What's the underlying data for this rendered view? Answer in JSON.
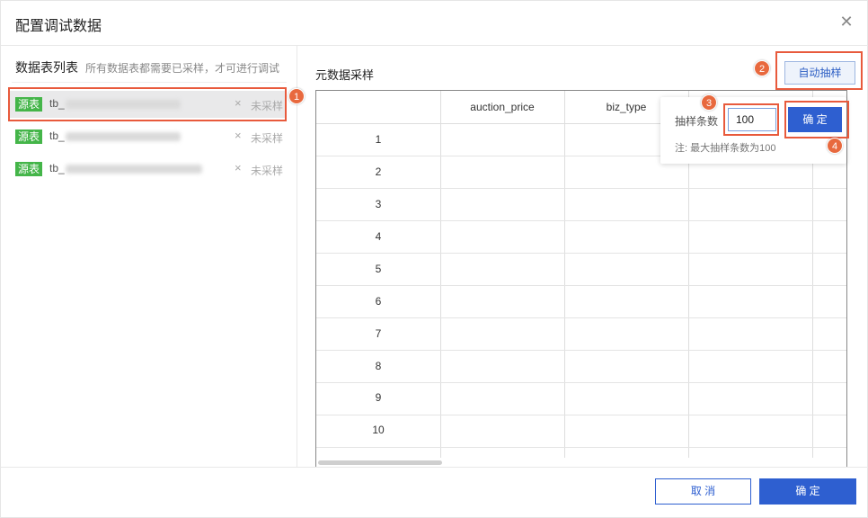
{
  "dialog": {
    "title": "配置调试数据",
    "close_icon": "close-icon"
  },
  "left": {
    "title": "数据表列表",
    "subtitle": "所有数据表都需要已采样，才可进行调试",
    "items": [
      {
        "tag": "源表",
        "name": "tb_",
        "remove": "×",
        "status": "未采样"
      },
      {
        "tag": "源表",
        "name": "tb_",
        "remove": "×",
        "status": "未采样"
      },
      {
        "tag": "源表",
        "name": "tb_",
        "remove": "×",
        "status": "未采样"
      }
    ]
  },
  "right": {
    "title": "元数据采样",
    "auto_sample_label": "自动抽样",
    "columns": [
      "",
      "auction_price",
      "biz_type",
      "",
      ""
    ],
    "rows": [
      "1",
      "2",
      "3",
      "4",
      "5",
      "6",
      "7",
      "8",
      "9",
      "10"
    ]
  },
  "popover": {
    "label": "抽样条数",
    "value": "100",
    "confirm_label": "确 定",
    "note": "注: 最大抽样条数为100"
  },
  "steps": [
    "1",
    "2",
    "3",
    "4"
  ],
  "footer": {
    "cancel_label": "取 消",
    "ok_label": "确 定"
  },
  "colors": {
    "primary": "#2e5fd0",
    "tag_green": "#44b549",
    "highlight_red": "#e85a3c"
  }
}
